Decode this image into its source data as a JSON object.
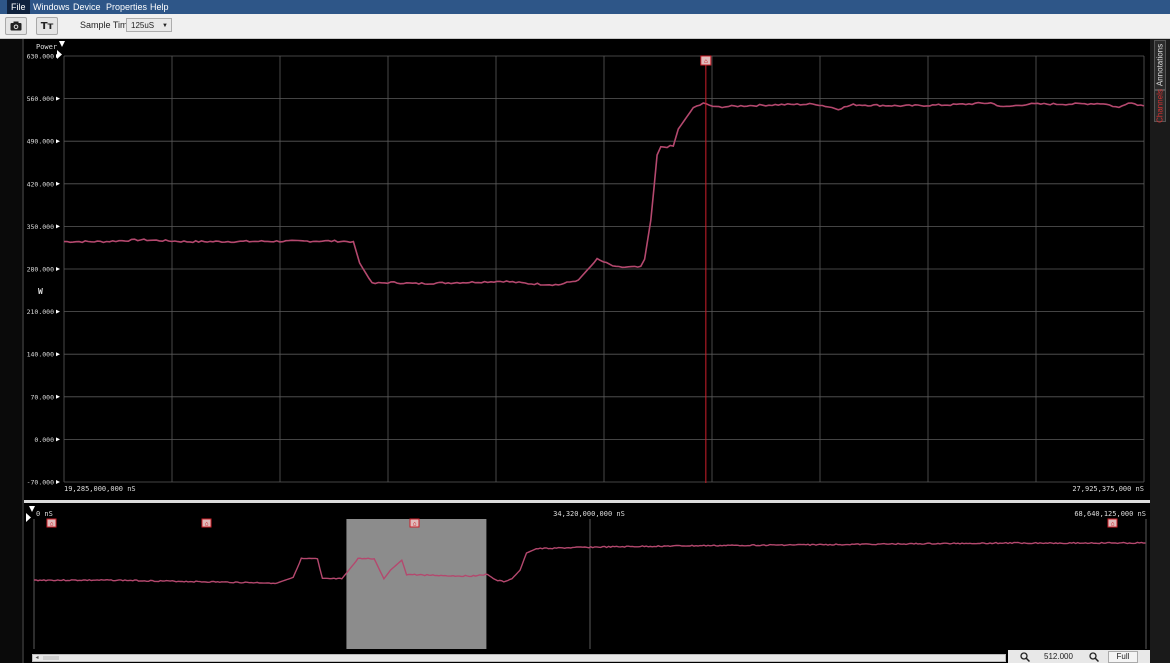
{
  "menu": [
    "File",
    "Windows",
    "Device",
    "Properties",
    "Help"
  ],
  "toolbar": {
    "camera_icon": "camera-icon",
    "text_button_label": "Tт",
    "sample_time_label": "Sample Time:",
    "sample_time_value": "125uS"
  },
  "right_tabs": [
    "Annotations",
    "Channels"
  ],
  "main_chart": {
    "series_title": "Power",
    "unit": "W",
    "y_ticks": [
      "630.000",
      "560.000",
      "490.000",
      "420.000",
      "350.000",
      "280.000",
      "210.000",
      "140.000",
      "70.000",
      "0.000",
      "-70.000"
    ],
    "x_start_label": "19,285,000,000 nS",
    "x_end_label": "27,925,375,000 nS",
    "marker_label": "⌂"
  },
  "overview": {
    "x_labels": [
      "0 nS",
      "34,320,000,000 nS",
      "68,640,125,000 nS"
    ]
  },
  "zoom": {
    "value": "512.000",
    "full_label": "Full"
  },
  "colors": {
    "trace": "#b4486e",
    "marker": "#cc1f2a",
    "menubar": "#2e5688"
  },
  "chart_data": [
    {
      "type": "line",
      "series": [
        {
          "values": [
            [
              19285,
              325
            ],
            [
              19600,
              325
            ],
            [
              19900,
              328
            ],
            [
              20270,
              325
            ],
            [
              20500,
              325
            ],
            [
              21400,
              326
            ],
            [
              21600,
              325
            ],
            [
              21650,
              290
            ],
            [
              21750,
              256
            ],
            [
              21900,
              258
            ],
            [
              22100,
              256
            ],
            [
              22500,
              258
            ],
            [
              22800,
              260
            ],
            [
              23000,
              256
            ],
            [
              23240,
              254
            ],
            [
              23400,
              262
            ],
            [
              23550,
              296
            ],
            [
              23700,
              283
            ],
            [
              23900,
              283
            ],
            [
              23930,
              296
            ],
            [
              23980,
              360
            ],
            [
              24030,
              467
            ],
            [
              24060,
              480
            ],
            [
              24160,
              482
            ],
            [
              24200,
              510
            ],
            [
              24320,
              545
            ],
            [
              24400,
              552
            ],
            [
              24500,
              546
            ],
            [
              24700,
              548
            ],
            [
              25000,
              550
            ],
            [
              25300,
              551
            ],
            [
              25480,
              543
            ],
            [
              25600,
              550
            ],
            [
              26000,
              548
            ],
            [
              26400,
              550
            ],
            [
              26700,
              553
            ],
            [
              26800,
              546
            ],
            [
              27000,
              551
            ],
            [
              27300,
              551
            ],
            [
              27600,
              552
            ],
            [
              27725,
              545
            ],
            [
              27800,
              554
            ],
            [
              27925,
              548
            ]
          ]
        }
      ],
      "x_unit": "million nS",
      "xlim": [
        19285,
        27925.375
      ],
      "ylim": [
        -70,
        630
      ],
      "ylabel": "W",
      "grid": true,
      "marker_x": 24420
    },
    {
      "type": "line",
      "series": [
        {
          "values": [
            [
              0,
              40
            ],
            [
              5,
              40
            ],
            [
              10,
              41
            ],
            [
              15,
              42
            ],
            [
              16,
              38
            ],
            [
              16.5,
              25
            ],
            [
              17.5,
              25
            ],
            [
              17.8,
              39
            ],
            [
              19,
              39
            ],
            [
              20,
              25
            ],
            [
              21,
              25
            ],
            [
              21.6,
              39
            ],
            [
              22,
              33
            ],
            [
              22.7,
              26
            ],
            [
              23,
              36
            ],
            [
              26,
              37
            ],
            [
              27,
              37
            ],
            [
              28,
              36
            ],
            [
              28.5,
              40
            ],
            [
              29,
              41
            ],
            [
              29.5,
              39
            ],
            [
              30,
              33
            ],
            [
              30.4,
              21
            ],
            [
              31,
              18
            ],
            [
              34,
              17
            ],
            [
              40,
              16
            ],
            [
              50,
              15
            ],
            [
              60,
              14
            ],
            [
              68.6,
              14
            ]
          ]
        }
      ],
      "x_unit": "billion nS",
      "xlim": [
        0,
        68.64
      ],
      "ylim": [
        0,
        50
      ],
      "grid": true,
      "selection": [
        19.285,
        27.925
      ]
    }
  ]
}
